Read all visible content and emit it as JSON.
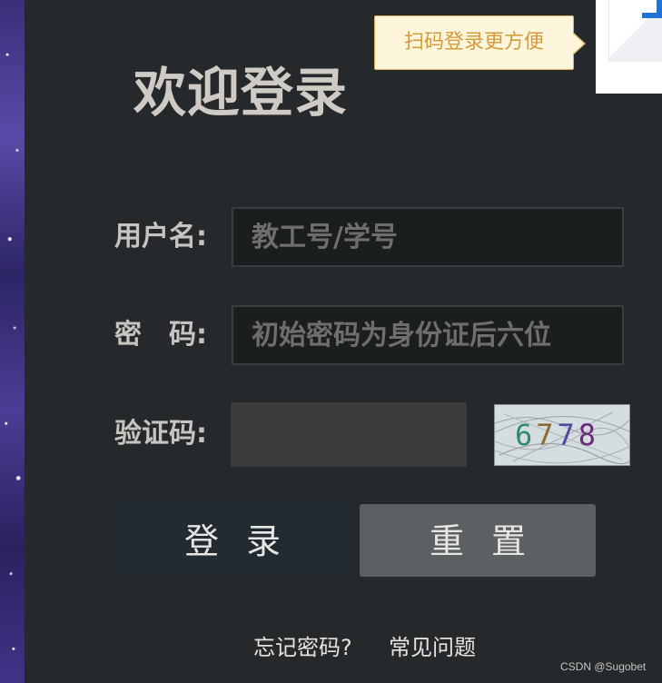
{
  "page": {
    "title": "欢迎登录",
    "tooltip": "扫码登录更方便"
  },
  "form": {
    "username_label": "用户名:",
    "username_placeholder": "教工号/学号",
    "password_label": "密　码:",
    "password_placeholder": "初始密码为身份证后六位",
    "captcha_label": "验证码:",
    "captcha_value": "",
    "captcha_text": [
      "6",
      "7",
      "7",
      "8"
    ]
  },
  "buttons": {
    "login": "登录",
    "reset": "重置"
  },
  "links": {
    "forgot_password": "忘记密码?",
    "faq": "常见问题"
  },
  "watermark": "CSDN @Sugobet",
  "colors": {
    "background": "#26292b",
    "tooltip_bg": "#fdf6dc",
    "tooltip_text": "#d59a3a",
    "login_button": "#222a32",
    "reset_button": "#5b6163"
  }
}
